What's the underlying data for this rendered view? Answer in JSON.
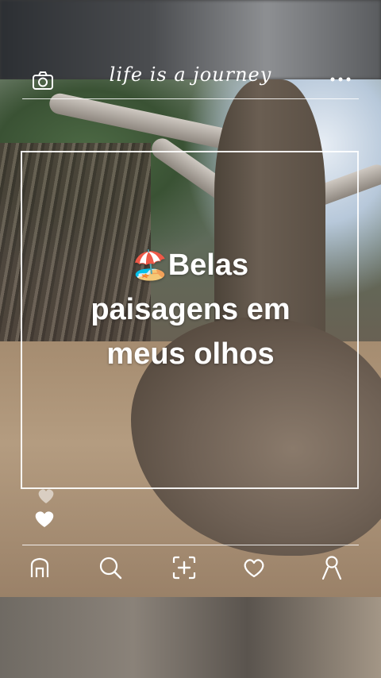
{
  "header": {
    "title": "life is a journey",
    "left_icon": "camera-icon",
    "right_icon": "more-icon"
  },
  "post": {
    "emoji": "🏖️",
    "caption_lines": [
      "Belas",
      "paisagens em",
      "meus olhos"
    ]
  },
  "reactions": {
    "like_icon": "heart-filled-icon",
    "floating_icon": "heart-floating-icon"
  },
  "nav": {
    "items": [
      {
        "icon": "home-icon"
      },
      {
        "icon": "search-icon"
      },
      {
        "icon": "add-post-icon"
      },
      {
        "icon": "heart-outline-icon"
      },
      {
        "icon": "profile-icon"
      }
    ]
  },
  "colors": {
    "overlay_text": "#ffffff",
    "frame_line": "#ffffff"
  }
}
